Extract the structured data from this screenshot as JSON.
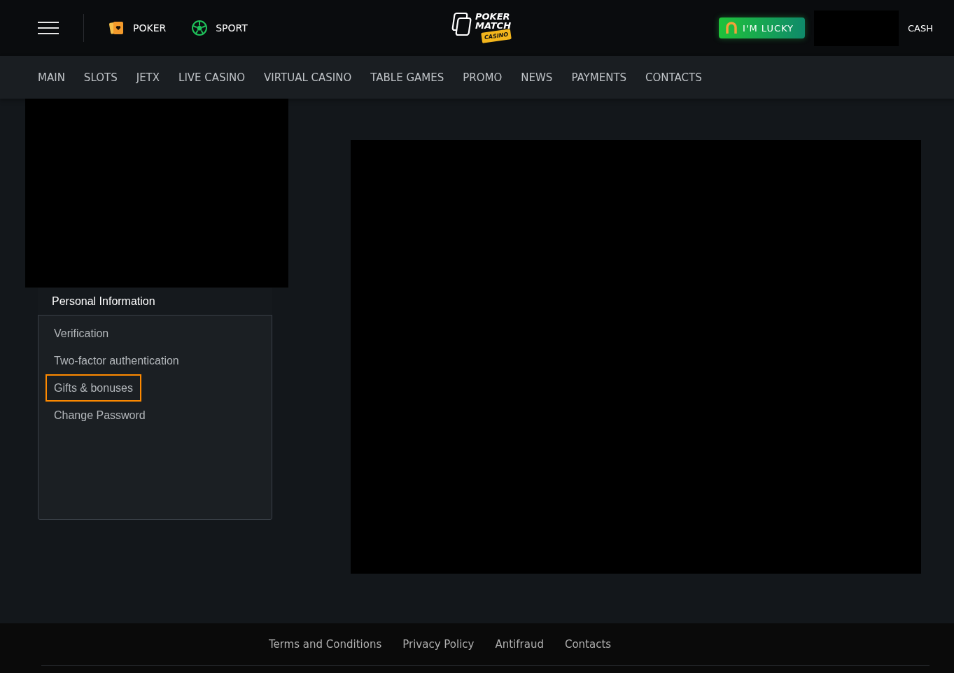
{
  "header": {
    "links": [
      {
        "label": "POKER",
        "kind": "poker"
      },
      {
        "label": "SPORT",
        "kind": "sport"
      }
    ],
    "logo": {
      "line_1": "POKER",
      "line_2": "MATCH",
      "badge": "CASINO"
    },
    "lucky_button": "I'M LUCKY",
    "cash_link": "CASH"
  },
  "nav": [
    {
      "label": "MAIN"
    },
    {
      "label": "SLOTS"
    },
    {
      "label": "JETX"
    },
    {
      "label": "LIVE CASINO"
    },
    {
      "label": "VIRTUAL CASINO"
    },
    {
      "label": "TABLE GAMES"
    },
    {
      "label": "PROMO"
    },
    {
      "label": "NEWS"
    },
    {
      "label": "PAYMENTS"
    },
    {
      "label": "CONTACTS"
    }
  ],
  "sidebar": {
    "heading": "Personal Information",
    "items": [
      {
        "label": "Verification",
        "highlighted": false
      },
      {
        "label": "Two-factor authentication",
        "highlighted": false
      },
      {
        "label": "Gifts & bonuses",
        "highlighted": true
      },
      {
        "label": "Change Password",
        "highlighted": false
      }
    ]
  },
  "footer": {
    "links": [
      "Terms and Conditions",
      "Privacy Policy",
      "Antifraud",
      "Contacts"
    ]
  }
}
